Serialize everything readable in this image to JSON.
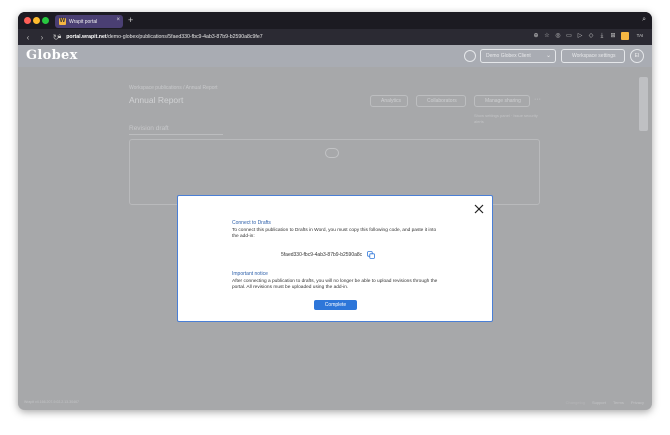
{
  "browser": {
    "tab_title": "Wrapit portal",
    "tab_favicon_letter": "W",
    "tab_close": "×",
    "new_tab": "+",
    "url_domain": "portal.wrapit.net",
    "url_path": "/demo-globex/publications/5faed330-fbc9-4ab3-87b9-b2590a8c9fe7",
    "user_badge": "TAI"
  },
  "header": {
    "logo": "Globex",
    "org_select_label": "Demo Globex Client",
    "workspace_label": "Workspace settings",
    "avatar_initials": "EI"
  },
  "background": {
    "breadcrumb": "Workspace publications  /  Annual Report",
    "page_title": "Annual Report",
    "actions": {
      "analytics": "Analytics",
      "collaborators": "Collaborators",
      "sharing": "Manage sharing",
      "more": "···"
    },
    "faded_note": "Show settings panel · Issue security alerts",
    "section_title": "Revision draft",
    "footer_version": "Wrapit v4.166.207-9.02.2.13-30467",
    "footer_links": [
      "Changelog",
      "Support",
      "Terms",
      "Privacy"
    ]
  },
  "modal": {
    "heading_connect": "Connect to Drafts",
    "instructions": "To connect this publication to Drafts in Word, you must copy this following code, and paste it into the add-in:",
    "code": "5faed330-fbc9-4ab3-87b9-b2590a8c",
    "heading_notice": "Important notice",
    "notice_text": "After connecting a publication to drafts, you will no longer be able to upload revisions through the portal. All revisions must be uploaded using the add-in.",
    "complete_label": "Complete"
  },
  "colors": {
    "accent": "#2d76d9",
    "heading": "#2b5ea9",
    "modal_border": "#4a7fd6",
    "tab_active": "#4a3f73"
  }
}
